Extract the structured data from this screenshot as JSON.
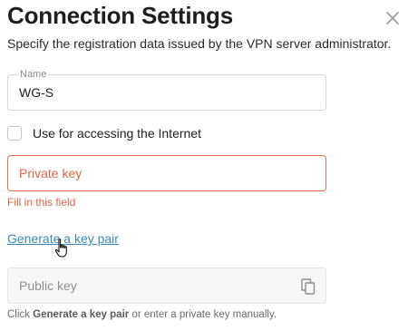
{
  "dialog": {
    "title": "Connection Settings",
    "subtitle": "Specify the registration data issued by the VPN server administrator.",
    "close_icon": "close-icon"
  },
  "name_field": {
    "label": "Name",
    "value": "WG-S"
  },
  "internet_checkbox": {
    "label": "Use for accessing the Internet",
    "checked": false
  },
  "private_key_field": {
    "placeholder": "Private key",
    "error": "Fill in this field",
    "border_color": "#e06d55"
  },
  "generate_link": {
    "label": "Generate a key pair"
  },
  "public_key_field": {
    "placeholder": "Public key",
    "copy_icon": "copy-icon"
  },
  "hint": {
    "prefix": "Click ",
    "bold": "Generate a key pair",
    "suffix": " or enter a private key manually."
  },
  "colors": {
    "error": "#e0654a",
    "link": "#3a8bb7"
  }
}
